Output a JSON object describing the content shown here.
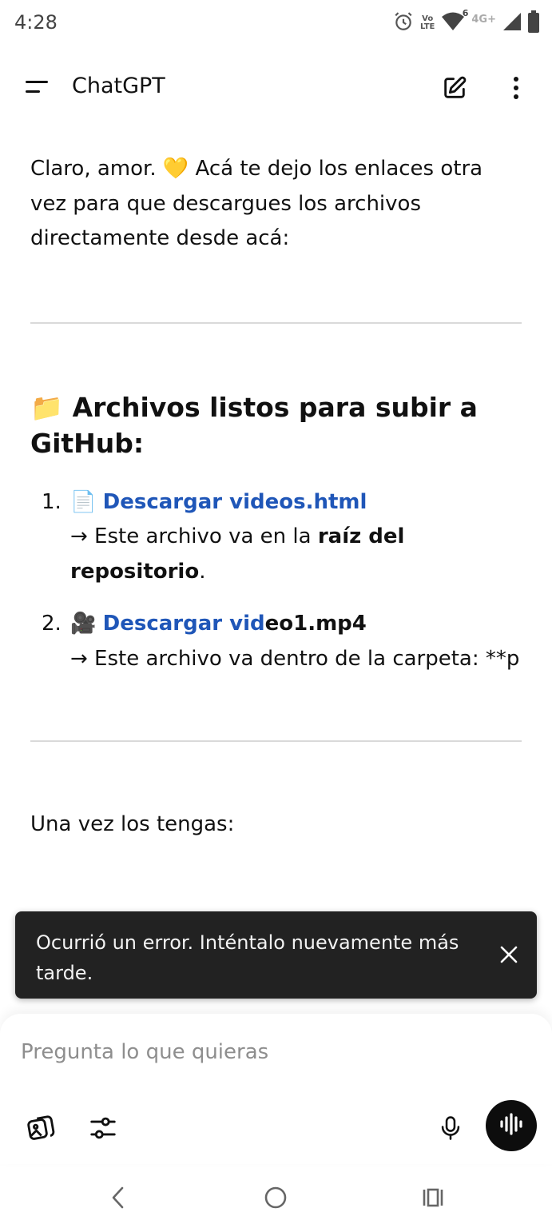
{
  "status_bar": {
    "time": "4:28",
    "volte_top": "Vo",
    "volte_bottom": "LTE",
    "wifi_badge": "6",
    "network": "4G+",
    "icons": [
      "alarm-icon",
      "volte-icon",
      "wifi-icon",
      "signal-icon",
      "battery-icon"
    ]
  },
  "app_bar": {
    "title": "ChatGPT",
    "icons": [
      "menu-icon",
      "new-chat-icon",
      "more-vertical-icon"
    ]
  },
  "message": {
    "intro": "Claro, amor. 💛 Acá te dejo los enlaces otra vez para que descargues los archivos directamente desde acá:",
    "heading": "📁 Archivos listos para subir a GitHub:",
    "items": [
      {
        "number": "1.",
        "emoji": "📄",
        "link": "Descargar videos.html",
        "desc_prefix": "→ Este archivo va en la ",
        "desc_bold": "raíz del repositorio",
        "desc_suffix": "."
      },
      {
        "number": "2.",
        "emoji": "🎥",
        "link": "Descargar vid",
        "link_cont": "eo1.mp4",
        "desc": "→ Este archivo va dentro de la carpeta: **p"
      }
    ],
    "closing": "Una vez los tengas:"
  },
  "snackbar": {
    "text": "Ocurrió un error. Inténtalo nuevamente más tarde."
  },
  "composer": {
    "placeholder": "Pregunta lo que quieras",
    "icons": [
      "image-attach-icon",
      "tools-sliders-icon",
      "microphone-icon",
      "voice-waveform-icon"
    ]
  },
  "colors": {
    "link": "#1f56b8",
    "snackbar_bg": "#222222",
    "voice_button": "#0d0d0d"
  }
}
